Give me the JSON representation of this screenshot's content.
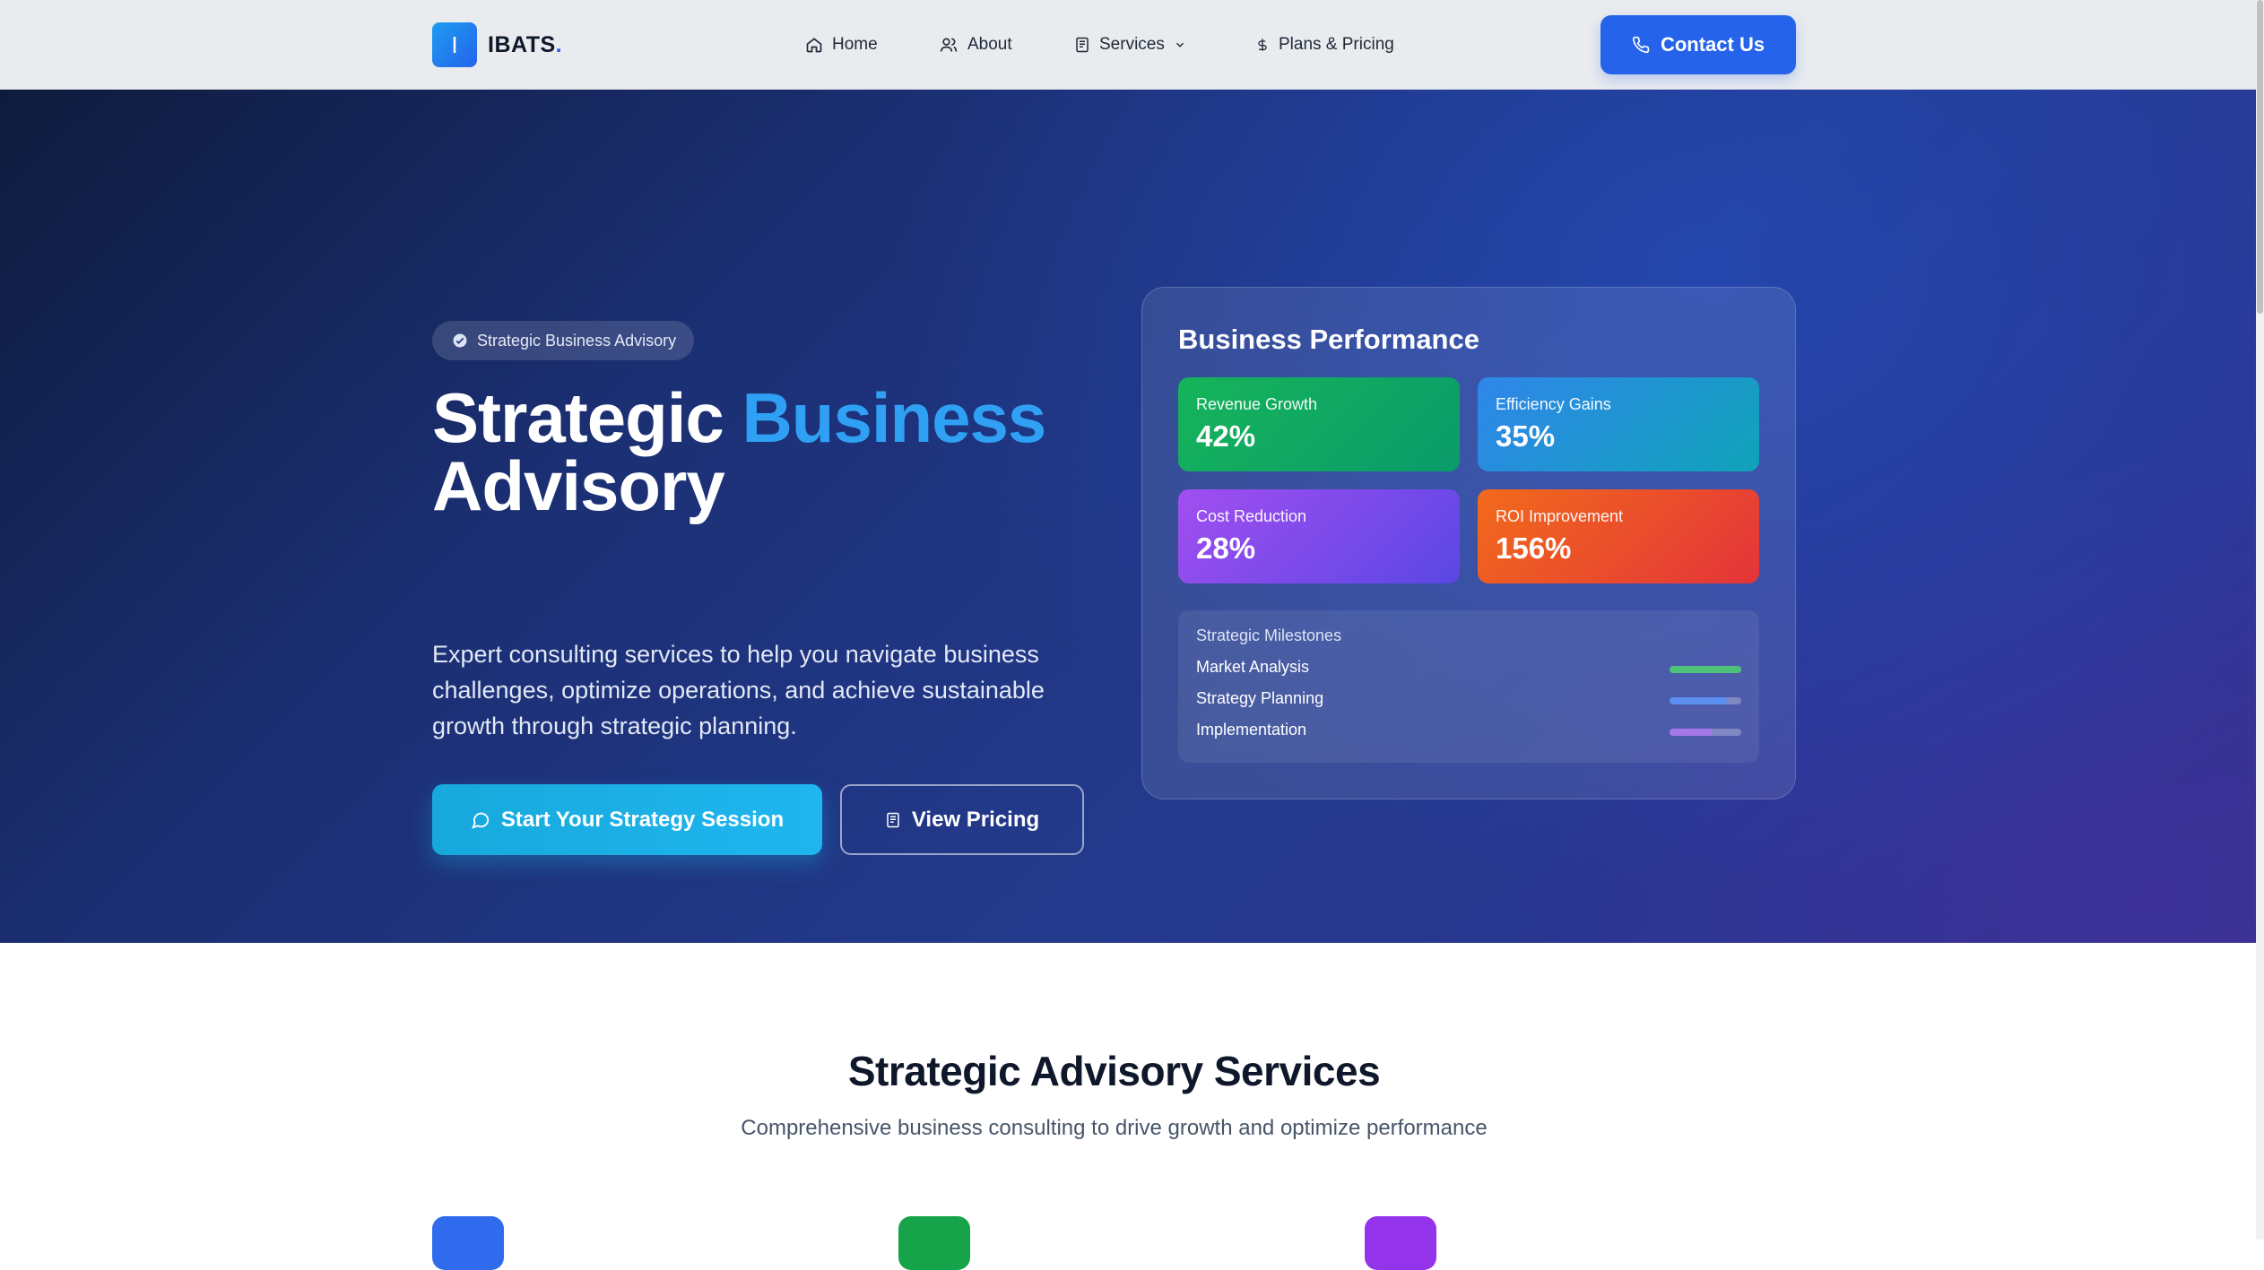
{
  "nav": {
    "logo_letter": "I",
    "logo_name": "IBATS",
    "logo_dot": ".",
    "links": [
      {
        "label": "Home",
        "icon": "home-icon"
      },
      {
        "label": "About",
        "icon": "users-icon"
      },
      {
        "label": "Services",
        "icon": "document-icon"
      },
      {
        "label": "Plans & Pricing",
        "icon": "dollar-icon"
      }
    ],
    "contact_label": "Contact Us"
  },
  "hero": {
    "badge": "Strategic Business Advisory",
    "title_part1": "Strategic ",
    "title_accent": "Business",
    "title_part2": "Advisory",
    "description": "Expert consulting services to help you navigate business challenges, optimize operations, and achieve sustainable growth through strategic planning.",
    "primary_button": "Start Your Strategy Session",
    "secondary_button": "View Pricing"
  },
  "performance": {
    "title": "Business Performance",
    "stats": [
      {
        "label": "Revenue Growth",
        "value": "42%"
      },
      {
        "label": "Efficiency Gains",
        "value": "35%"
      },
      {
        "label": "Cost Reduction",
        "value": "28%"
      },
      {
        "label": "ROI Improvement",
        "value": "156%"
      }
    ],
    "milestones_heading": "Strategic Milestones",
    "milestones": [
      {
        "label": "Market Analysis",
        "progress": 1.0,
        "color": "#4fc27a"
      },
      {
        "label": "Strategy Planning",
        "progress": 0.8,
        "color": "#5b8ff0"
      },
      {
        "label": "Implementation",
        "progress": 0.6,
        "color": "#a678ea"
      }
    ]
  },
  "services": {
    "title": "Strategic Advisory Services",
    "subtitle": "Comprehensive business consulting to drive growth and optimize performance"
  }
}
